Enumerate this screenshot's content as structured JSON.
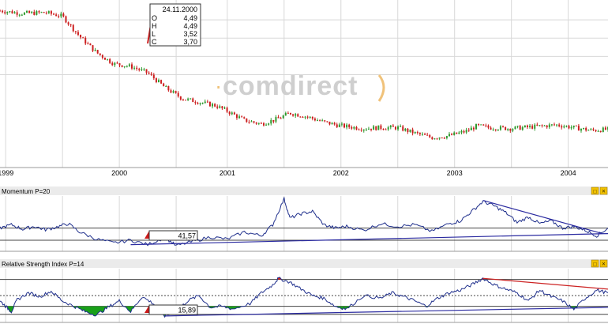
{
  "watermark": "comdirect",
  "colors": {
    "up": "#2e9a2e",
    "down": "#cc1f1f",
    "indicator_line": "#1f2f8c",
    "trend_line": "#2a2aa0",
    "rsi_trend_red": "#cc2222",
    "fill_green": "#19a019",
    "fill_red": "#cc1a1a",
    "grid": "#d8d8d8",
    "panel_bar": "#ebebeb",
    "watermark": "#cfcfcf",
    "watermark_accent": "#f0c27a"
  },
  "chart_data": [
    {
      "type": "candlestick",
      "title": "",
      "x_labels": [
        "1999",
        "2000",
        "2001",
        "2002",
        "2003",
        "2004"
      ],
      "x_range": [
        1999.0,
        2004.35
      ],
      "ylim": [
        0.5,
        9.5
      ],
      "tooltip": {
        "date": "24.11.2000",
        "fields": [
          {
            "key": "O",
            "value": "4,49"
          },
          {
            "key": "H",
            "value": "4,49"
          },
          {
            "key": "L",
            "value": "3,52"
          },
          {
            "key": "C",
            "value": "3,70"
          }
        ]
      },
      "price_path": [
        [
          1999.0,
          9.0
        ],
        [
          1999.2,
          8.85
        ],
        [
          1999.4,
          8.9
        ],
        [
          1999.55,
          8.7
        ],
        [
          1999.7,
          7.6
        ],
        [
          1999.85,
          6.7
        ],
        [
          2000.0,
          6.1
        ],
        [
          2000.15,
          5.95
        ],
        [
          2000.3,
          5.6
        ],
        [
          2000.45,
          4.8
        ],
        [
          2000.6,
          4.2
        ],
        [
          2000.75,
          4.0
        ],
        [
          2000.9,
          3.8
        ],
        [
          2001.0,
          3.5
        ],
        [
          2001.15,
          3.0
        ],
        [
          2001.3,
          2.8
        ],
        [
          2001.45,
          3.1
        ],
        [
          2001.55,
          3.4
        ],
        [
          2001.7,
          3.2
        ],
        [
          2001.85,
          2.9
        ],
        [
          2002.0,
          2.7
        ],
        [
          2002.2,
          2.55
        ],
        [
          2002.35,
          2.6
        ],
        [
          2002.5,
          2.6
        ],
        [
          2002.65,
          2.3
        ],
        [
          2002.8,
          2.05
        ],
        [
          2002.95,
          2.15
        ],
        [
          2003.1,
          2.4
        ],
        [
          2003.2,
          2.7
        ],
        [
          2003.3,
          2.6
        ],
        [
          2003.5,
          2.55
        ],
        [
          2003.7,
          2.65
        ],
        [
          2003.9,
          2.75
        ],
        [
          2004.05,
          2.6
        ],
        [
          2004.2,
          2.45
        ],
        [
          2004.35,
          2.5
        ]
      ]
    },
    {
      "type": "line",
      "title": "Momentum P=20",
      "value_label": "41,57",
      "x_range": [
        1999.0,
        2004.35
      ],
      "ylim": [
        0,
        100
      ],
      "series": [
        {
          "values": [
            [
              1999.0,
              42
            ],
            [
              1999.1,
              48
            ],
            [
              1999.2,
              40
            ],
            [
              1999.3,
              45
            ],
            [
              1999.4,
              39
            ],
            [
              1999.5,
              44
            ],
            [
              1999.6,
              50
            ],
            [
              1999.7,
              35
            ],
            [
              1999.85,
              22
            ],
            [
              2000.0,
              15
            ],
            [
              2000.15,
              20
            ],
            [
              2000.3,
              12
            ],
            [
              2000.45,
              25
            ],
            [
              2000.55,
              10
            ],
            [
              2000.7,
              18
            ],
            [
              2000.85,
              26
            ],
            [
              2001.0,
              22
            ],
            [
              2001.15,
              35
            ],
            [
              2001.3,
              28
            ],
            [
              2001.4,
              48
            ],
            [
              2001.5,
              95
            ],
            [
              2001.55,
              60
            ],
            [
              2001.65,
              68
            ],
            [
              2001.75,
              72
            ],
            [
              2001.85,
              48
            ],
            [
              2001.95,
              42
            ],
            [
              2002.05,
              45
            ],
            [
              2002.2,
              38
            ],
            [
              2002.35,
              50
            ],
            [
              2002.5,
              45
            ],
            [
              2002.65,
              48
            ],
            [
              2002.8,
              36
            ],
            [
              2002.95,
              50
            ],
            [
              2003.05,
              55
            ],
            [
              2003.15,
              72
            ],
            [
              2003.25,
              90
            ],
            [
              2003.35,
              82
            ],
            [
              2003.45,
              70
            ],
            [
              2003.55,
              52
            ],
            [
              2003.65,
              62
            ],
            [
              2003.75,
              50
            ],
            [
              2003.85,
              55
            ],
            [
              2003.95,
              42
            ],
            [
              2004.05,
              45
            ],
            [
              2004.15,
              38
            ],
            [
              2004.25,
              28
            ],
            [
              2004.35,
              42
            ]
          ]
        }
      ],
      "reference_lines": [
        42,
        20
      ],
      "trend_lines": [
        {
          "from": [
            2000.15,
            12
          ],
          "to": [
            2004.35,
            32
          ]
        },
        {
          "from": [
            2003.25,
            92
          ],
          "to": [
            2004.3,
            32
          ]
        }
      ]
    },
    {
      "type": "line",
      "title": "Relative Strength Index P=14",
      "value_label": "15,89",
      "x_range": [
        1999.0,
        2004.35
      ],
      "ylim": [
        0,
        100
      ],
      "series": [
        {
          "values": [
            [
              1999.0,
              40
            ],
            [
              1999.05,
              30
            ],
            [
              1999.1,
              20
            ],
            [
              1999.15,
              42
            ],
            [
              1999.25,
              55
            ],
            [
              1999.35,
              48
            ],
            [
              1999.45,
              58
            ],
            [
              1999.55,
              40
            ],
            [
              1999.65,
              30
            ],
            [
              1999.75,
              20
            ],
            [
              1999.85,
              14
            ],
            [
              1999.95,
              28
            ],
            [
              2000.05,
              40
            ],
            [
              2000.15,
              20
            ],
            [
              2000.25,
              48
            ],
            [
              2000.35,
              35
            ],
            [
              2000.45,
              12
            ],
            [
              2000.55,
              20
            ],
            [
              2000.65,
              40
            ],
            [
              2000.75,
              50
            ],
            [
              2000.85,
              28
            ],
            [
              2000.95,
              30
            ],
            [
              2001.05,
              25
            ],
            [
              2001.2,
              35
            ],
            [
              2001.3,
              55
            ],
            [
              2001.4,
              70
            ],
            [
              2001.45,
              82
            ],
            [
              2001.55,
              75
            ],
            [
              2001.65,
              62
            ],
            [
              2001.75,
              50
            ],
            [
              2001.85,
              45
            ],
            [
              2001.95,
              30
            ],
            [
              2002.05,
              25
            ],
            [
              2002.2,
              50
            ],
            [
              2002.35,
              45
            ],
            [
              2002.45,
              55
            ],
            [
              2002.55,
              48
            ],
            [
              2002.65,
              40
            ],
            [
              2002.75,
              30
            ],
            [
              2002.85,
              45
            ],
            [
              2002.95,
              55
            ],
            [
              2003.05,
              60
            ],
            [
              2003.15,
              70
            ],
            [
              2003.25,
              82
            ],
            [
              2003.35,
              70
            ],
            [
              2003.45,
              62
            ],
            [
              2003.55,
              55
            ],
            [
              2003.65,
              40
            ],
            [
              2003.75,
              60
            ],
            [
              2003.85,
              48
            ],
            [
              2003.95,
              40
            ],
            [
              2004.05,
              24
            ],
            [
              2004.15,
              45
            ],
            [
              2004.25,
              60
            ],
            [
              2004.35,
              55
            ]
          ]
        }
      ],
      "reference_lines": [
        80,
        50,
        30,
        15
      ],
      "trend_lines": [
        {
          "from": [
            2000.45,
            12
          ],
          "to": [
            2004.35,
            28
          ],
          "color": "trend_line"
        },
        {
          "from": [
            2003.25,
            82
          ],
          "to": [
            2004.35,
            62
          ],
          "color": "rsi_trend_red"
        }
      ]
    }
  ]
}
